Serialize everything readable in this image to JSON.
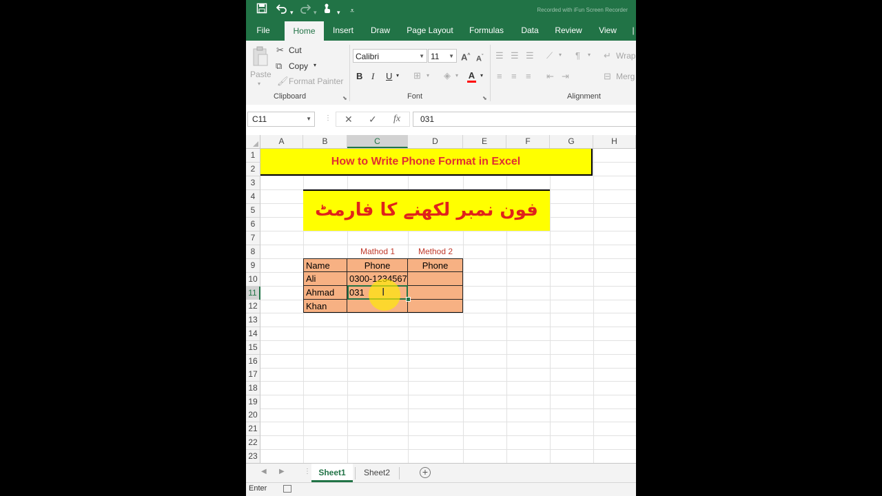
{
  "window": {
    "watermark": "Recorded with iFun Screen Recorder"
  },
  "qat": {
    "icons": [
      "save-icon",
      "undo-icon",
      "redo-icon",
      "touch-mode-icon",
      "customize-icon"
    ]
  },
  "tabs": [
    "File",
    "Home",
    "Insert",
    "Draw",
    "Page Layout",
    "Formulas",
    "Data",
    "Review",
    "View"
  ],
  "active_tab": "Home",
  "ribbon": {
    "clipboard": {
      "paste": "Paste",
      "cut": "Cut",
      "copy": "Copy",
      "format_painter": "Format Painter",
      "label": "Clipboard"
    },
    "font": {
      "name": "Calibri",
      "size": "11",
      "grow": "A",
      "shrink": "A",
      "bold": "B",
      "italic": "I",
      "underline": "U",
      "label": "Font",
      "font_color": "#ff0000"
    },
    "alignment": {
      "wrap": "Wrap",
      "merge": "Merg",
      "label": "Alignment"
    }
  },
  "formula_bar": {
    "name_box": "C11",
    "fx": "fx",
    "value": "031"
  },
  "columns": [
    "A",
    "B",
    "C",
    "D",
    "E",
    "F",
    "G",
    "H"
  ],
  "selected_column": "C",
  "rows": [
    "1",
    "2",
    "3",
    "4",
    "5",
    "6",
    "7",
    "8",
    "9",
    "10",
    "11",
    "12",
    "13",
    "14",
    "15",
    "16",
    "17",
    "18",
    "19",
    "20",
    "21",
    "22",
    "23"
  ],
  "selected_row": "11",
  "sheet": {
    "title": "How to Write Phone Format in Excel",
    "urdu_title": "فون نمبر لکھنے کا فارمٹ",
    "method1": "Mathod 1",
    "method2": "Method 2",
    "table": {
      "headers": [
        "Name",
        "Phone",
        "Phone"
      ],
      "rows": [
        [
          "Ali",
          "0300-1234567",
          ""
        ],
        [
          "Ahmad",
          "031",
          ""
        ],
        [
          "Khan",
          "",
          ""
        ]
      ]
    },
    "colors": {
      "title_fill": "#ffff00",
      "title_text": "#e03030",
      "table_fill": "#f7b183"
    }
  },
  "sheet_tabs": [
    "Sheet1",
    "Sheet2"
  ],
  "active_sheet": "Sheet1",
  "status": {
    "mode": "Enter"
  }
}
